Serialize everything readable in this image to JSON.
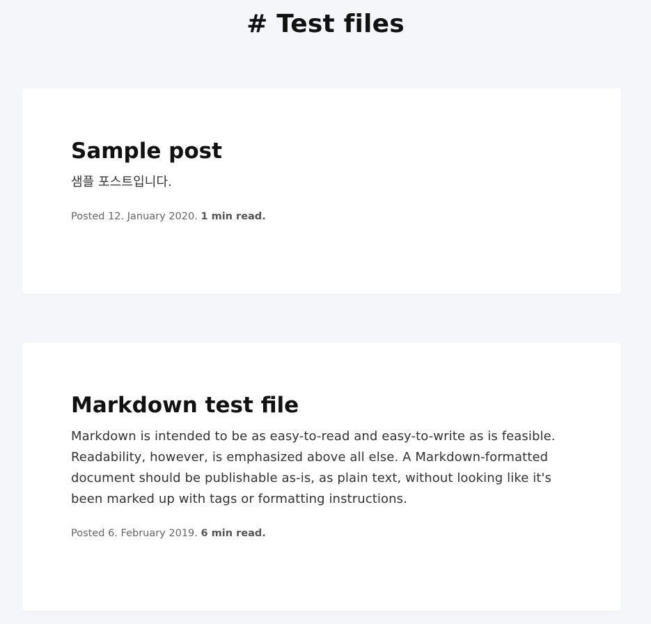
{
  "header": {
    "title": "# Test files"
  },
  "posts": [
    {
      "title": "Sample post",
      "excerpt": "샘플 포스트입니다.",
      "posted_prefix": "Posted 12. January 2020.",
      "read_time": "1 min read."
    },
    {
      "title": "Markdown test file",
      "excerpt": "Markdown is intended to be as easy-to-read and easy-to-write as is feasible. Readability, however, is emphasized above all else. A Markdown-formatted document should be publishable as-is, as plain text, without looking like it's been marked up with tags or formatting instructions.",
      "posted_prefix": "Posted 6. February 2019.",
      "read_time": "6 min read."
    }
  ],
  "colors": {
    "background": "#f4f6f9",
    "card": "#ffffff",
    "title_text": "#111111",
    "meta_text": "#666666"
  }
}
